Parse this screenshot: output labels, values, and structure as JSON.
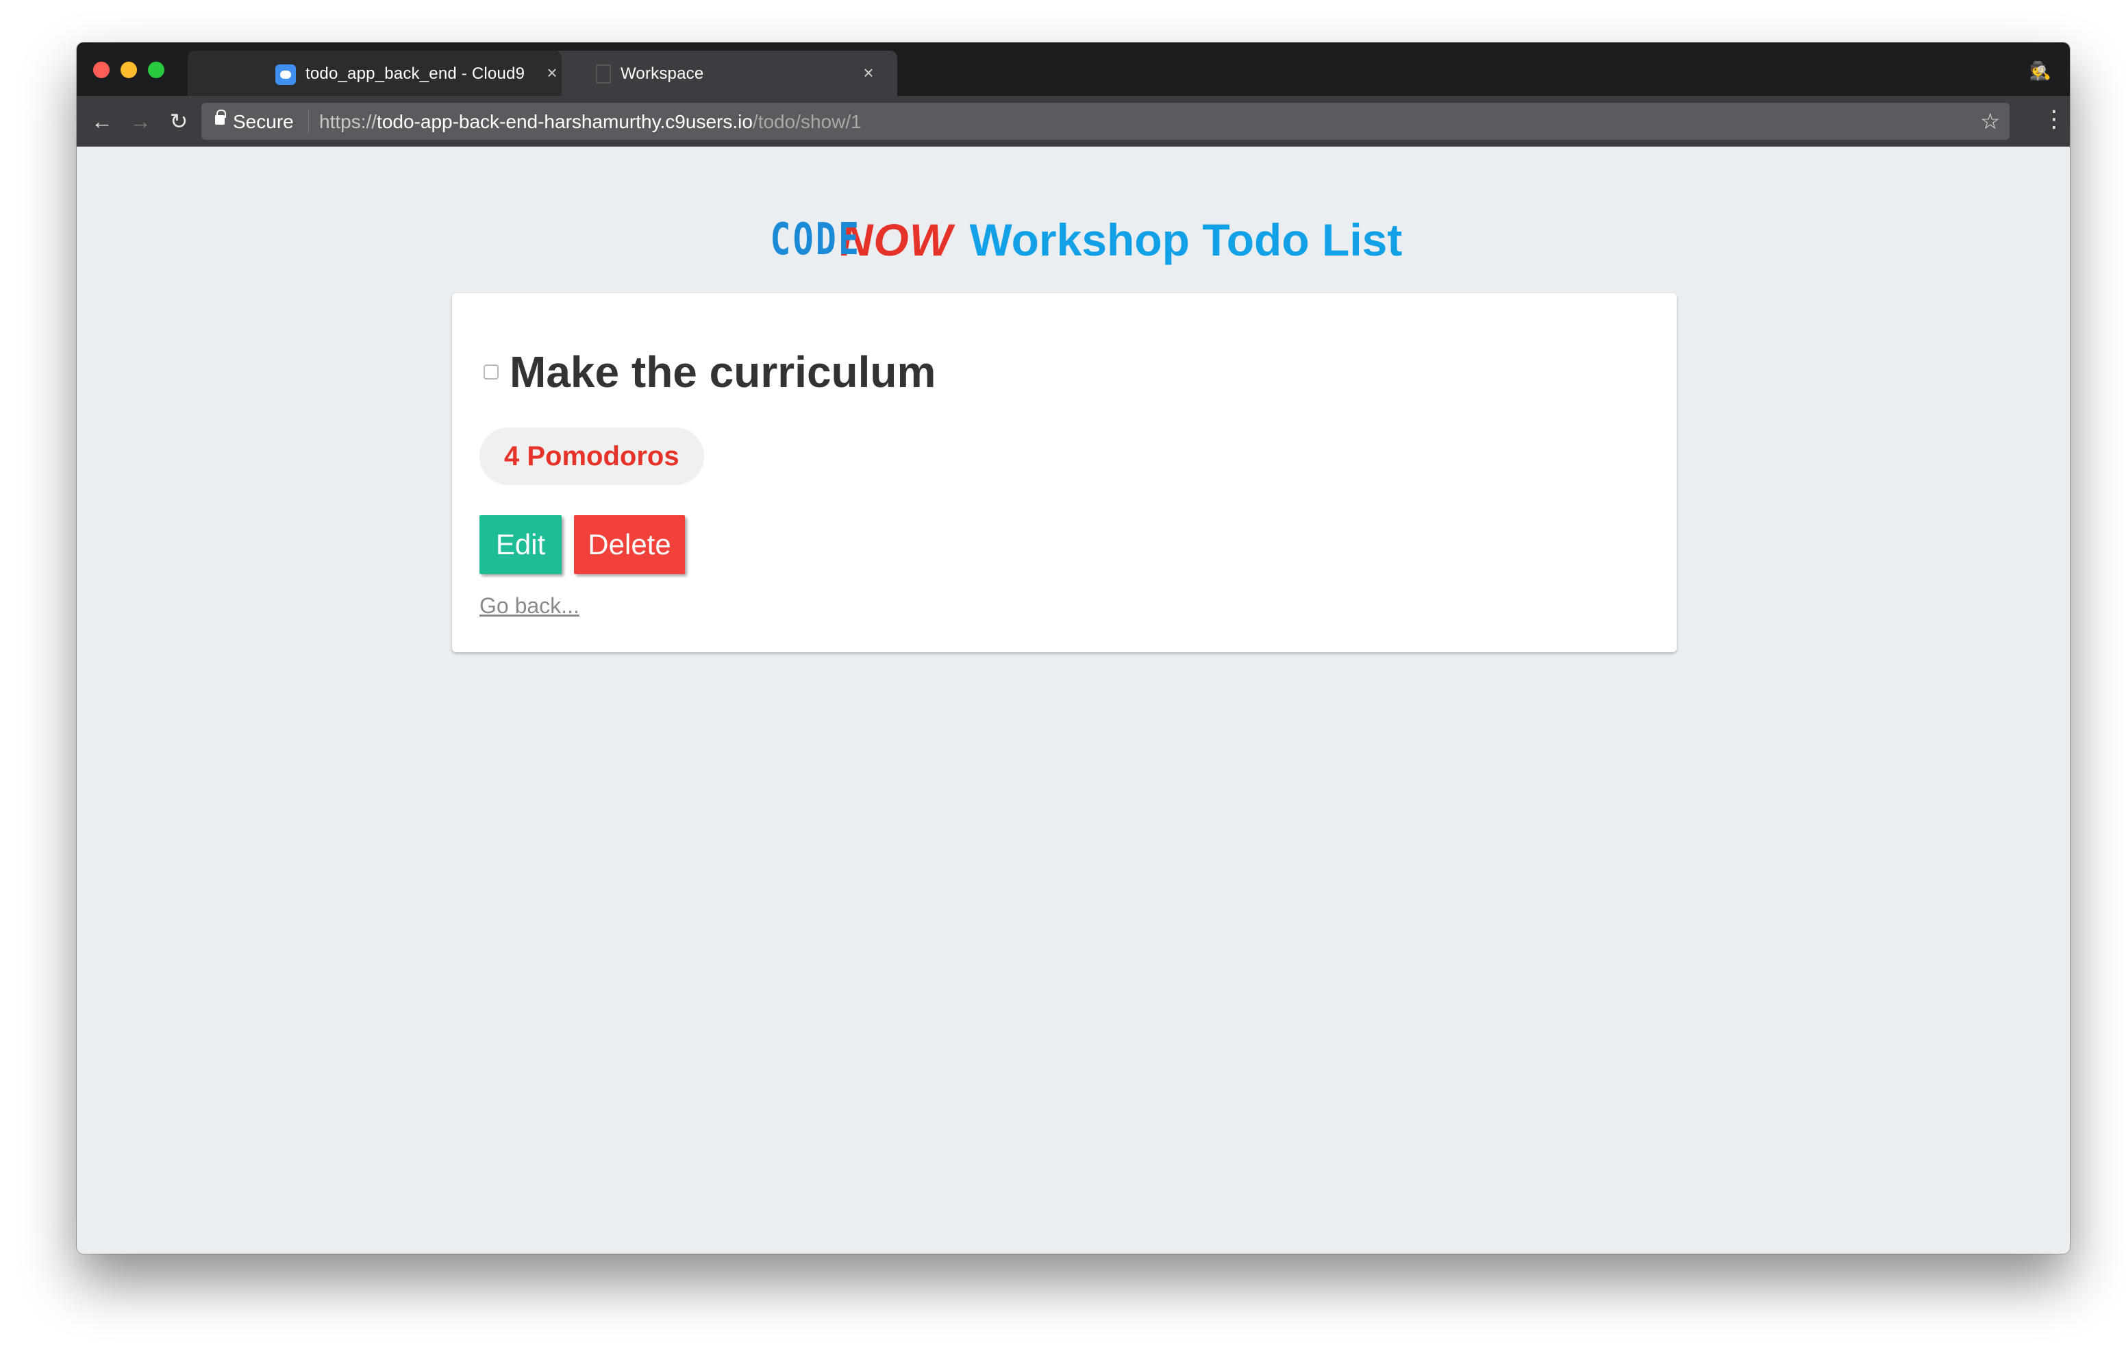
{
  "browser": {
    "tabs": [
      {
        "title": "todo_app_back_end - Cloud9",
        "close": "×",
        "active": true
      },
      {
        "title": "Workspace",
        "close": "×",
        "active": false
      }
    ],
    "security_label": "Secure",
    "url": {
      "scheme": "https://",
      "host": "todo-app-back-end-harshamurthy.c9users.io",
      "path": "/todo/show/1"
    },
    "nav_icons": {
      "back": "←",
      "forward": "→",
      "reload": "↻",
      "star": "☆",
      "menu": "⋮",
      "incognito": "🕵"
    },
    "colors": {
      "tab_strip": "#1c1d1f",
      "toolbar": "#3c3d40"
    }
  },
  "app": {
    "logo_code": "CODE",
    "logo_now": "NOW",
    "title": "Workshop Todo List",
    "colors": {
      "brand_blue": "#12a1e6",
      "brand_red": "#e63329",
      "page_bg": "#ebeef1"
    }
  },
  "todo": {
    "title": "Make the curriculum",
    "checked": false,
    "pomodoros_label": "4 Pomodoros"
  },
  "actions": {
    "edit_label": "Edit",
    "delete_label": "Delete",
    "back_link": "Go back...",
    "colors": {
      "edit": "#1ebc97",
      "delete": "#f2413a"
    }
  }
}
